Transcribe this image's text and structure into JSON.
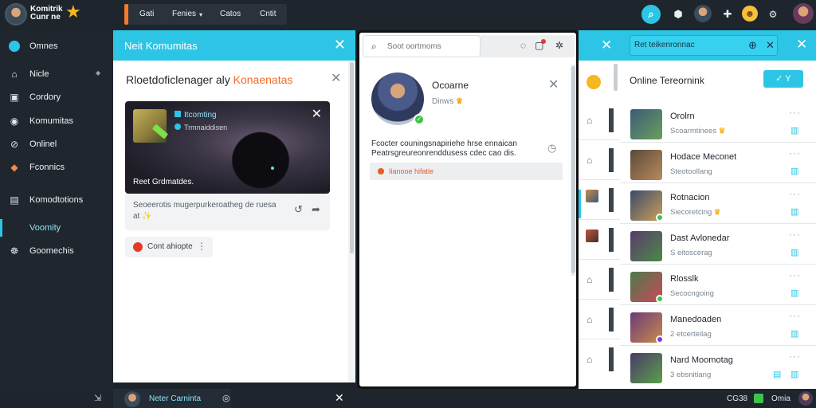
{
  "app": {
    "logo_text": "Komitrik Cunr ne",
    "logo_icon": "star-icon"
  },
  "topnav": {
    "items": [
      "Gati",
      "Fenies",
      "Catos",
      "Cntit"
    ],
    "dropdown_icon": "chevron-down-icon"
  },
  "sidebar": {
    "items": [
      {
        "label": "Omnes",
        "icon": "globe-icon"
      },
      {
        "label": "Nicle",
        "icon": "home-icon"
      },
      {
        "label": "Cordory",
        "icon": "folder-icon"
      },
      {
        "label": "Komumitas",
        "icon": "community-icon"
      },
      {
        "label": "Onlinel",
        "icon": "link-icon"
      },
      {
        "label": "Fconnics",
        "icon": "bookmark-icon"
      },
      {
        "label": "Komodtotions",
        "icon": "list-icon"
      },
      {
        "label": "Voomity",
        "icon": "chat-icon"
      },
      {
        "label": "Goomechis",
        "icon": "settings-icon"
      }
    ],
    "active_index": 7
  },
  "panel1": {
    "header": "Neit Komumitas",
    "title_prefix": "Rloetdoficlenager aly",
    "title_highlight": "Konaenatas",
    "card": {
      "badge1": "Itcomting",
      "badge2": "Trmnaiddisen",
      "caption": "Reet Grdmatdes."
    },
    "desc": "Seoeerotis mugerpurkeroatheg de ruesa  at ✨",
    "button": "Cont ahiopte"
  },
  "panel2": {
    "search_placeholder": "Soot oortmoms",
    "profile_name": "Ocoarne",
    "profile_sub": "Dinws",
    "text": "Fcocter couningsnapiriehe hrse ennaican Peatrsgreureonrenddusess cdec cao dis.",
    "alert": "Iianooe hifatie"
  },
  "panel3": {
    "search_placeholder": "Ret teikenronnac",
    "title": "Online Tereornink",
    "button": "✓  Y",
    "rows": [
      {
        "name": "Orolrn",
        "status": "Scoarmtinees",
        "star": true,
        "online": "",
        "avatar": [
          "#3a5a7a",
          "#6aa05a"
        ]
      },
      {
        "name": "Hodace Meconet",
        "status": "Steotoollang",
        "star": false,
        "online": "",
        "avatar": [
          "#5a4a3a",
          "#b98a5a"
        ]
      },
      {
        "name": "Rotnacion",
        "status": "Siecoretcing",
        "star": true,
        "online": "#3cc34a",
        "avatar": [
          "#3a4a6a",
          "#c9a05a"
        ]
      },
      {
        "name": "Dast Avlonedar",
        "status": "S eitoscerag",
        "star": false,
        "online": "",
        "avatar": [
          "#5a3a6a",
          "#4a8a4a"
        ]
      },
      {
        "name": "Rlosslk",
        "status": "Secocngoing",
        "star": false,
        "online": "#3cc34a",
        "avatar": [
          "#4a7a4a",
          "#c9495a"
        ]
      },
      {
        "name": "Manedoaden",
        "status": "2 etcerteilag",
        "star": false,
        "online": "#8a3ad0",
        "avatar": [
          "#6a3a7a",
          "#c98a4a"
        ]
      },
      {
        "name": "Nard Moomotag",
        "status": "3 ebsnitiang",
        "star": false,
        "online": "",
        "avatar": [
          "#4a3a6a",
          "#5aa04a"
        ]
      }
    ]
  },
  "bottombar": {
    "chat_name": "Neter Carninta",
    "status1": "CG38",
    "status2": "Omia"
  },
  "colors": {
    "accent": "#2dc5e5",
    "orange": "#f47b2b",
    "green": "#3cc34a"
  }
}
